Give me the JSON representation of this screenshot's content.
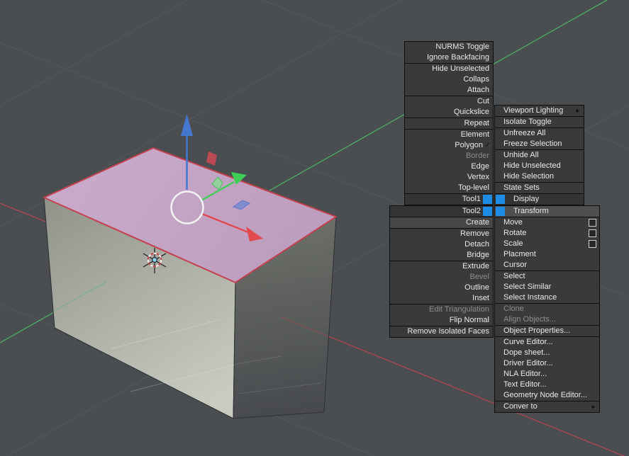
{
  "colors": {
    "viewport_background": "#4a4e51",
    "menu_background": "#3a3a3a",
    "menu_border": "#0f0f0f",
    "menu_text": "#e9e9e9",
    "menu_text_disabled": "#8d8d8d",
    "quad_badge_blue": "#1e8be4",
    "highlight_row": "#4f4f4f",
    "axis_x_red": "#bc4650",
    "axis_y_green": "#4db56a",
    "gizmo_x_red": "#e14b50",
    "gizmo_y_green": "#3fcf56",
    "gizmo_z_blue": "#4677d0",
    "selected_face_pink": "#c3a3c3",
    "selected_edge_red": "#c2414d",
    "cursor_center_blue": "#8fd2ec"
  },
  "icons": {
    "submenu_arrow": "►",
    "checkmark": "✓",
    "quad_badge": "blue-square",
    "settings_box": "white-outline-square"
  },
  "quad_menu": {
    "tools1": {
      "title": "Tool1",
      "sections": [
        [
          "NURMS Toggle",
          "Ignore Backfacing"
        ],
        [
          "Hide Unselected",
          "Collaps",
          "Attach"
        ],
        [
          "Cut",
          "Quickslice"
        ],
        [
          "Repeat"
        ],
        [
          "Element",
          "Polygon",
          "Border",
          "Edge",
          "Vertex",
          "Top-level"
        ]
      ],
      "checked_item": "Polygon",
      "disabled_items": [
        "Border"
      ]
    },
    "tools2": {
      "title": "Tool2",
      "sections": [
        [
          "Create"
        ],
        [
          "Remove",
          "Detach",
          "Bridge"
        ],
        [
          "Extrude",
          "Bevel",
          "Outline",
          "Inset"
        ],
        [
          "Edit Triangulation",
          "Flip Normal"
        ],
        [
          "Remove Isolated Faces"
        ]
      ],
      "disabled_items": [
        "Bevel",
        "Edit Triangulation"
      ]
    },
    "display": {
      "title": "Display",
      "sections": [
        [
          "Viewport Lighting"
        ],
        [
          "Isolate Toggle"
        ],
        [
          "Unfreeze All",
          "Freeze Selection"
        ],
        [
          "Unhide All",
          "Hide Unselected",
          "Hide Selection"
        ],
        [
          "State Sets"
        ]
      ],
      "submenu_items": [
        "Viewport Lighting"
      ]
    },
    "transform": {
      "title": "Transform",
      "sections": [
        [
          "Move",
          "Rotate",
          "Scale",
          "Placment",
          "Cursor"
        ],
        [
          "Select",
          "Select Similar",
          "Select Instance"
        ],
        [
          "Clone",
          "Align Objects..."
        ],
        [
          "Object Properties..."
        ],
        [
          "Curve Editor...",
          "Dope sheet...",
          "Driver Editor...",
          "NLA Editor...",
          "Text Editor...",
          "Geometry Node Editor..."
        ],
        [
          "Conver to"
        ]
      ],
      "disabled_items": [
        "Clone",
        "Align Objects..."
      ],
      "settings_items": [
        "Move",
        "Rotate",
        "Scale"
      ],
      "submenu_items": [
        "Conver to"
      ]
    }
  }
}
